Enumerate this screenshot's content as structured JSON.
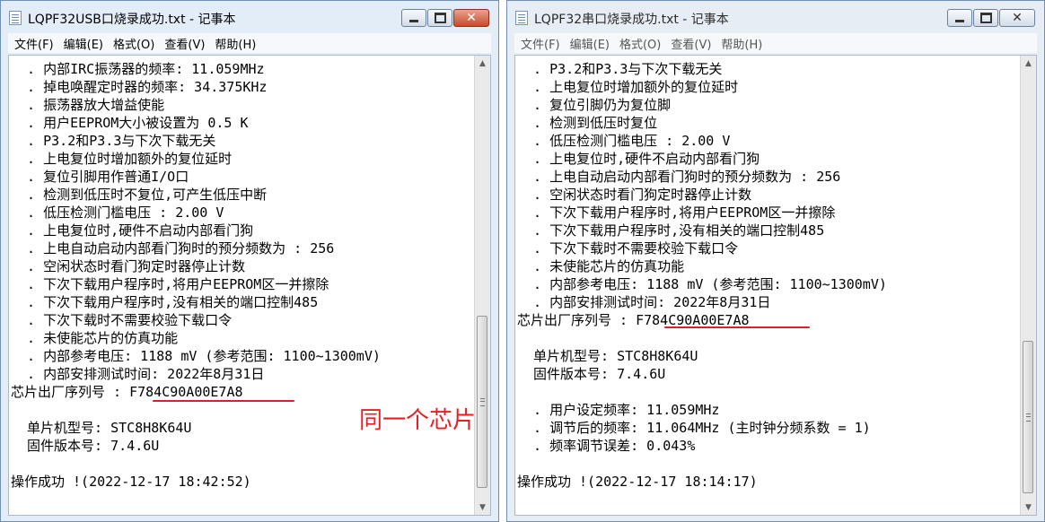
{
  "menu": [
    "文件(F)",
    "编辑(E)",
    "格式(O)",
    "查看(V)",
    "帮助(H)"
  ],
  "windows": {
    "left": {
      "title": "LQPF32USB口烧录成功.txt - 记事本",
      "lines": [
        "  . 内部IRC振荡器的频率: 11.059MHz",
        "  . 掉电唤醒定时器的频率: 34.375KHz",
        "  . 振荡器放大增益使能",
        "  . 用户EEPROM大小被设置为 0.5 K",
        "  . P3.2和P3.3与下次下载无关",
        "  . 上电复位时增加额外的复位延时",
        "  . 复位引脚用作普通I/O口",
        "  . 检测到低压时不复位,可产生低压中断",
        "  . 低压检测门槛电压 : 2.00 V",
        "  . 上电复位时,硬件不启动内部看门狗",
        "  . 上电自动启动内部看门狗时的预分频数为 : 256",
        "  . 空闲状态时看门狗定时器停止计数",
        "  . 下次下载用户程序时,将用户EEPROM区一并擦除",
        "  . 下次下载用户程序时,没有相关的端口控制485",
        "  . 下次下载时不需要校验下载口令",
        "  . 未使能芯片的仿真功能",
        "  . 内部参考电压: 1188 mV (参考范围: 1100~1300mV)",
        "  . 内部安排测试时间: 2022年8月31日",
        "芯片出厂序列号 : F784C90A00E7A8",
        "",
        "  单片机型号: STC8H8K64U",
        "  固件版本号: 7.4.6U",
        "",
        "操作成功 !(2022-12-17 18:42:52)"
      ]
    },
    "right": {
      "title": "LQPF32串口烧录成功.txt - 记事本",
      "lines": [
        "  . P3.2和P3.3与下次下载无关",
        "  . 上电复位时增加额外的复位延时",
        "  . 复位引脚仍为复位脚",
        "  . 检测到低压时复位",
        "  . 低压检测门槛电压 : 2.00 V",
        "  . 上电复位时,硬件不启动内部看门狗",
        "  . 上电自动启动内部看门狗时的预分频数为 : 256",
        "  . 空闲状态时看门狗定时器停止计数",
        "  . 下次下载用户程序时,将用户EEPROM区一并擦除",
        "  . 下次下载用户程序时,没有相关的端口控制485",
        "  . 下次下载时不需要校验下载口令",
        "  . 未使能芯片的仿真功能",
        "  . 内部参考电压: 1188 mV (参考范围: 1100~1300mV)",
        "  . 内部安排测试时间: 2022年8月31日",
        "芯片出厂序列号 : F784C90A00E7A8",
        "",
        "  单片机型号: STC8H8K64U",
        "  固件版本号: 7.4.6U",
        "",
        "  . 用户设定频率: 11.059MHz",
        "  . 调节后的频率: 11.064MHz (主时钟分频系数 = 1)",
        "  . 频率调节误差: 0.043%",
        "",
        "操作成功 !(2022-12-17 18:14:17)"
      ]
    }
  },
  "annotation": "同一个芯片",
  "colors": {
    "highlight_red": "#e01d2a"
  }
}
